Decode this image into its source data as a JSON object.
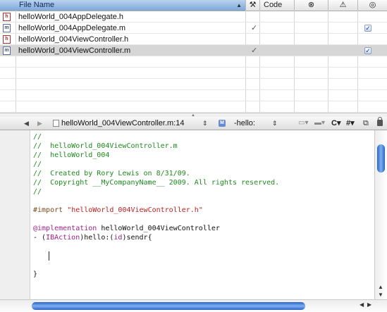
{
  "file_table": {
    "columns": {
      "filename": "File Name",
      "build_icon": "hammer-icon",
      "code": "Code",
      "errors_icon": "error-icon",
      "warnings_icon": "warning-icon",
      "target_icon": "target-icon"
    },
    "rows": [
      {
        "name": "helloWorld_004AppDelegate.h",
        "type": "h",
        "built": false,
        "in_target": false,
        "selected": false
      },
      {
        "name": "helloWorld_004AppDelegate.m",
        "type": "m",
        "built": true,
        "in_target": true,
        "selected": false
      },
      {
        "name": "helloWorld_004ViewController.h",
        "type": "h",
        "built": false,
        "in_target": false,
        "selected": false
      },
      {
        "name": "helloWorld_004ViewController.m",
        "type": "m",
        "built": true,
        "in_target": true,
        "selected": true
      }
    ],
    "check_glyph": "✓",
    "icon_letter": "h",
    "icon_letter_m": "m"
  },
  "nav_bar": {
    "file_popup": "helloWorld_004ViewController.m:14",
    "method_popup": "-hello:",
    "method_icon_letter": "M",
    "class_menu": "C",
    "include_menu": "#",
    "back_glyph": "◀",
    "forward_glyph": "▶",
    "popup_arrows": "⇕"
  },
  "editor": {
    "lines": [
      {
        "cls": "cmt",
        "text": "//"
      },
      {
        "cls": "cmt",
        "text": "//  helloWorld_004ViewController.m"
      },
      {
        "cls": "cmt",
        "text": "//  helloWorld_004"
      },
      {
        "cls": "cmt",
        "text": "//"
      },
      {
        "cls": "cmt",
        "text": "//  Created by Rory Lewis on 8/31/09."
      },
      {
        "cls": "cmt",
        "text": "//  Copyright __MyCompanyName__ 2009. All rights reserved."
      },
      {
        "cls": "cmt",
        "text": "//"
      },
      {
        "cls": "",
        "text": ""
      },
      {
        "cls": "import",
        "directive": "#import",
        "path": "\"helloWorld_004ViewController.h\""
      },
      {
        "cls": "",
        "text": ""
      },
      {
        "cls": "impl",
        "keyword": "@implementation",
        "rest": " helloWorld_004ViewController"
      },
      {
        "cls": "method",
        "prefix": "- (",
        "type1": "IBAction",
        "mid": ")hello:(",
        "type2": "id",
        "end": ")sendr{"
      },
      {
        "cls": "",
        "text": ""
      },
      {
        "cls": "",
        "text": ""
      },
      {
        "cls": "",
        "text": ""
      },
      {
        "cls": "",
        "text": "}"
      }
    ]
  },
  "scrollbars": {
    "up_glyph": "▲",
    "down_glyph": "▼",
    "left_glyph": "◀",
    "right_glyph": "▶"
  }
}
